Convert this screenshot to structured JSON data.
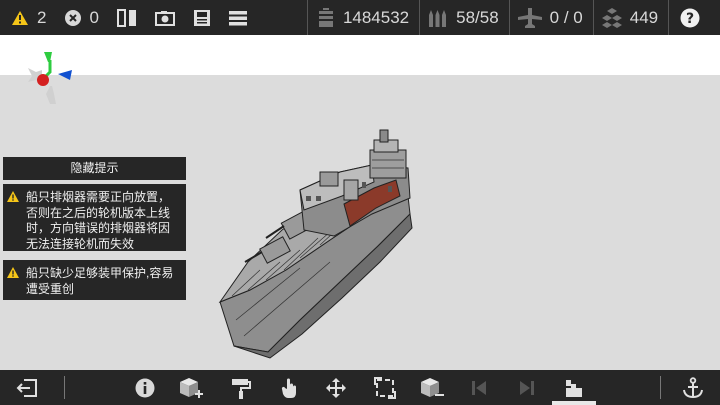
{
  "topbar": {
    "warnings_count": "2",
    "errors_count": "0",
    "mass": "1484532",
    "ammo": "58/58",
    "aircraft": "0 / 0",
    "blocks": "449"
  },
  "hints": {
    "toggle_label": "隐藏提示",
    "items": [
      "船只排烟器需要正向放置，否则在之后的轮机版本上线时，方向错误的排烟器将因无法连接轮机而失效",
      "船只缺少足够装甲保护,容易遭受重创"
    ]
  },
  "colors": {
    "bar_bg": "#262626",
    "warning": "#f5c518",
    "gizmo_green": "#2ecc40",
    "gizmo_blue": "#1050d0",
    "gizmo_red": "#d42020",
    "deck_red": "#8b3a2a"
  },
  "icons": {
    "top": [
      "warning-icon",
      "error-icon",
      "mirror-icon",
      "screenshot-icon",
      "save-icon",
      "menu-icon",
      "weight-icon",
      "ammo-icon",
      "aircraft-icon",
      "blocks-icon",
      "help-icon"
    ],
    "bottom": [
      "exit-icon",
      "info-icon",
      "add-block-icon",
      "paint-roller-icon",
      "hand-icon",
      "move-icon",
      "resize-icon",
      "block-remove-icon",
      "prev-icon",
      "next-icon",
      "layers-icon",
      "anchor-icon"
    ]
  }
}
